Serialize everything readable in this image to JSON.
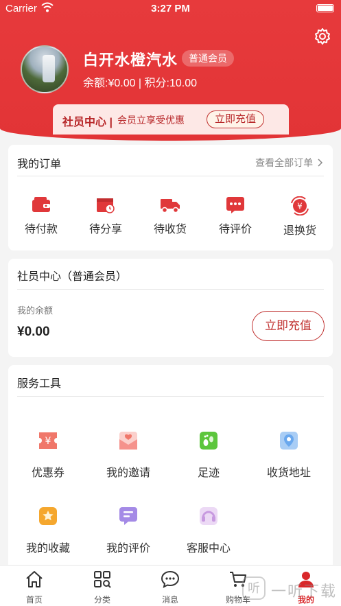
{
  "status_bar": {
    "carrier": "Carrier",
    "time": "3:27 PM"
  },
  "profile": {
    "name": "白开水橙汽水",
    "level": "普通会员",
    "balance_line": "余额:¥0.00 | 积分:10.00"
  },
  "banner": {
    "title": "社员中心 |",
    "subtitle": "会员立享受优惠",
    "button": "立即充值"
  },
  "orders": {
    "title": "我的订单",
    "view_all": "查看全部订单",
    "items": [
      {
        "label": "待付款",
        "icon": "wallet-icon"
      },
      {
        "label": "待分享",
        "icon": "share-calendar-icon"
      },
      {
        "label": "待收货",
        "icon": "truck-icon"
      },
      {
        "label": "待评价",
        "icon": "comment-icon"
      },
      {
        "label": "退换货",
        "icon": "refund-icon"
      }
    ]
  },
  "member_center": {
    "title": "社员中心（普通会员）",
    "balance_label": "我的余额",
    "balance_value": "¥0.00",
    "recharge_button": "立即充值"
  },
  "tools": {
    "title": "服务工具",
    "items": [
      {
        "label": "优惠券",
        "icon": "coupon-icon",
        "color": "#f0776a"
      },
      {
        "label": "我的邀请",
        "icon": "invite-icon",
        "color": "#f5928c"
      },
      {
        "label": "足迹",
        "icon": "footprint-icon",
        "color": "#5cc63c"
      },
      {
        "label": "收货地址",
        "icon": "location-icon",
        "color": "#6aa8ee"
      },
      {
        "label": "我的收藏",
        "icon": "star-icon",
        "color": "#f5a72e"
      },
      {
        "label": "我的评价",
        "icon": "review-icon",
        "color": "#a48ae6"
      },
      {
        "label": "客服中心",
        "icon": "headset-icon",
        "color": "#c89ae0"
      }
    ]
  },
  "tabbar": {
    "items": [
      {
        "label": "首页",
        "icon": "home-icon"
      },
      {
        "label": "分类",
        "icon": "category-icon"
      },
      {
        "label": "消息",
        "icon": "message-icon"
      },
      {
        "label": "购物车",
        "icon": "cart-icon"
      },
      {
        "label": "我的",
        "icon": "profile-icon",
        "active": true
      }
    ]
  },
  "watermark": {
    "logo_text": "听",
    "text": "一听下载"
  },
  "colors": {
    "accent": "#e23436",
    "dark_red": "#b8282a",
    "background": "#f4f4f4"
  }
}
